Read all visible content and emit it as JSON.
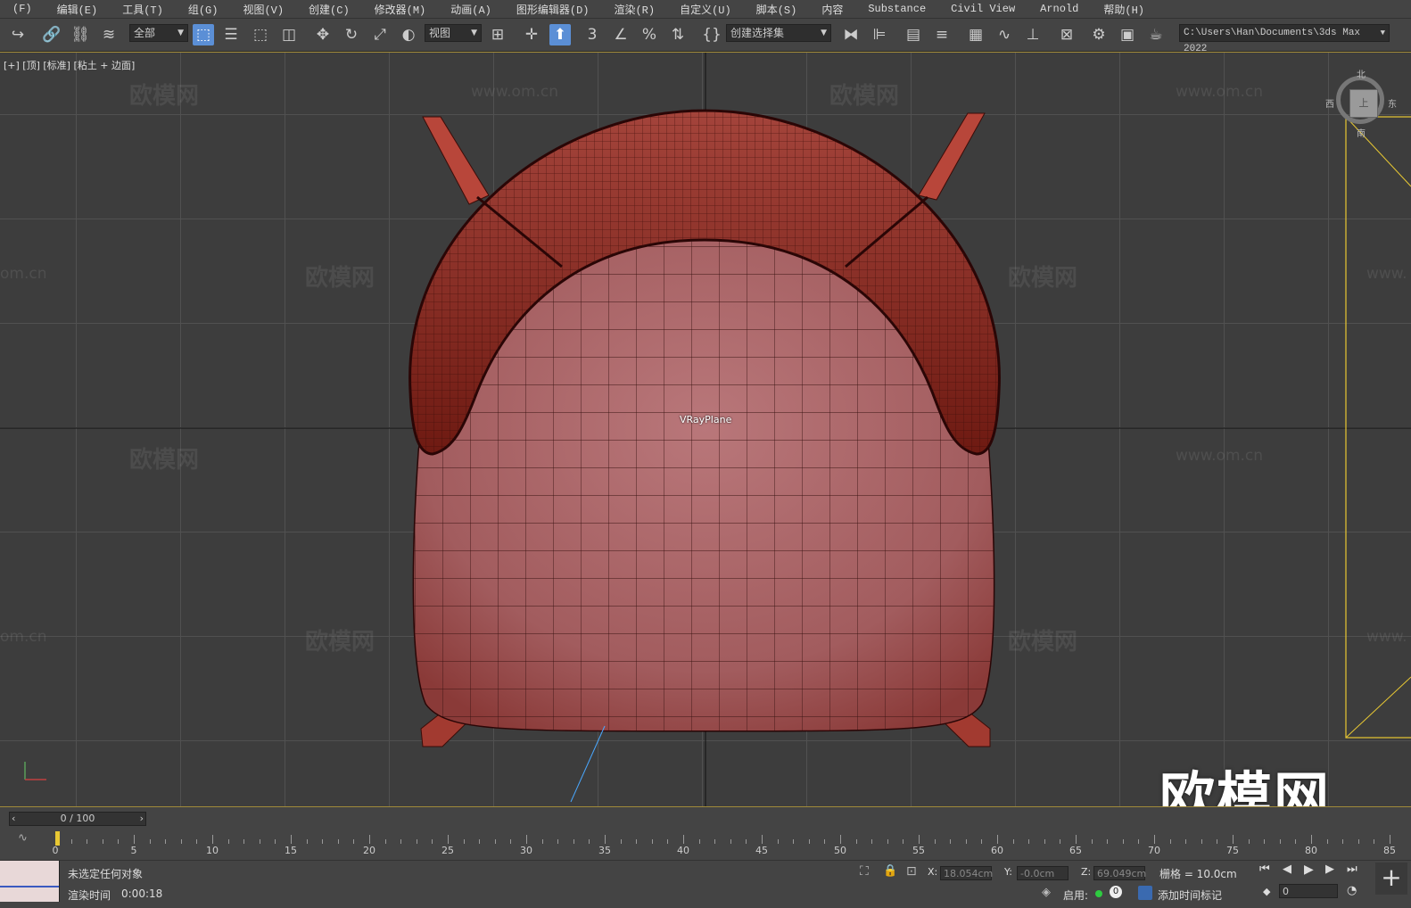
{
  "menu": [
    "(F)",
    "编辑(E)",
    "工具(T)",
    "组(G)",
    "视图(V)",
    "创建(C)",
    "修改器(M)",
    "动画(A)",
    "图形编辑器(D)",
    "渲染(R)",
    "自定义(U)",
    "脚本(S)",
    "内容",
    "Substance",
    "Civil View",
    "Arnold",
    "帮助(H)"
  ],
  "toolbar": {
    "selection_filter": "全部",
    "ref_coord": "视图",
    "named_selection": "创建选择集",
    "path": "C:\\Users\\Han\\Documents\\3ds Max 2022"
  },
  "viewport": {
    "label": "[+] [顶] [标准] [粘土 + 边面]",
    "object_label": "VRayPlane",
    "viewcube_north": "北",
    "viewcube_south": "南",
    "viewcube_east": "东",
    "viewcube_west": "西",
    "viewcube_face": "上",
    "watermark_cn": "欧模网",
    "watermark_url": "www.om.cn",
    "watermark_url_partial": "om.cn",
    "watermark_url_trunc": "www.",
    "brand": "欧模网"
  },
  "timeline": {
    "frame": "0 / 100",
    "ticks": [
      "0",
      "5",
      "10",
      "15",
      "20",
      "25",
      "30",
      "35",
      "40",
      "45",
      "50",
      "55",
      "60",
      "65",
      "70",
      "75",
      "80",
      "85"
    ]
  },
  "status": {
    "selection": "未选定任何对象",
    "render_time_label": "渲染时间",
    "render_time": "0:00:18",
    "x_label": "X:",
    "x_value": "18.054cm",
    "y_label": "Y:",
    "y_value": "-0.0cm",
    "z_label": "Z:",
    "z_value": "69.049cm",
    "grid": "栅格 = 10.0cm",
    "enable": "启用:",
    "enable_value": "0",
    "add_time_tag": "添加时间标记",
    "frame_field": "0"
  },
  "colors": {
    "accent": "#5b8fd6",
    "chair_dark": "#7a1d14",
    "chair_light": "#b9777a",
    "highlight": "#e8c833"
  }
}
